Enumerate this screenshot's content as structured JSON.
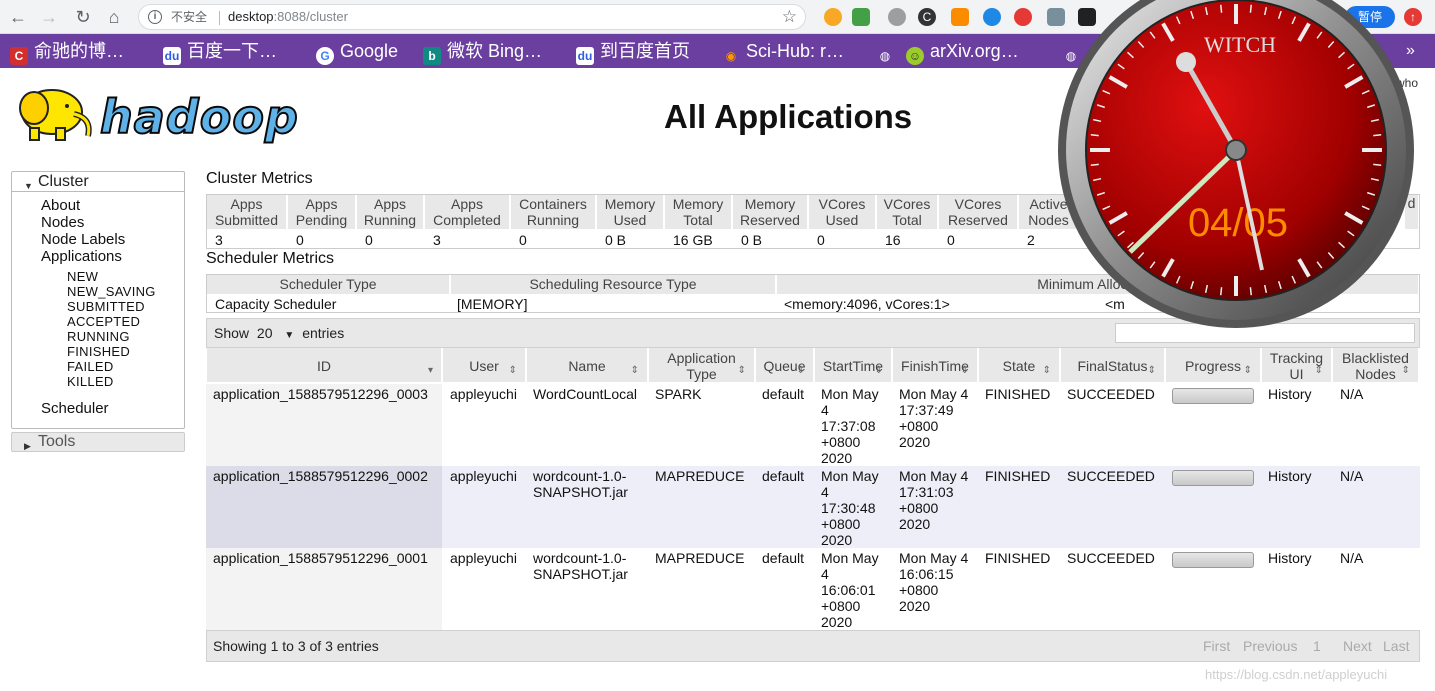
{
  "browser": {
    "insecure_label": "不安全",
    "url_host": "desktop",
    "url_rest": ":8088/cluster",
    "paused_label": "暂停"
  },
  "bookmarks": [
    {
      "label": "俞驰的博…",
      "icon_color": "#d32f2f",
      "icon_char": "C"
    },
    {
      "label": "百度一下…",
      "icon_color": "#2d5ee3",
      "icon_char": "du"
    },
    {
      "label": "Google",
      "icon_color": "#ffffff",
      "icon_char": "G"
    },
    {
      "label": "微软 Bing…",
      "icon_color": "#128a84",
      "icon_char": "b"
    },
    {
      "label": "到百度首页",
      "icon_color": "#2d5ee3",
      "icon_char": "du"
    },
    {
      "label": "Sci-Hub: r…",
      "icon_color": "#e65100",
      "icon_char": "◉"
    },
    {
      "label": "arXiv.org…",
      "icon_color": "#9ccc2a",
      "icon_char": "☺"
    }
  ],
  "header": {
    "logo_text": "hadoop",
    "title": "All Applications",
    "logged_in": "who"
  },
  "sidebar": {
    "cluster_label": "Cluster",
    "links": [
      "About",
      "Nodes",
      "Node Labels",
      "Applications"
    ],
    "states": [
      "NEW",
      "NEW_SAVING",
      "SUBMITTED",
      "ACCEPTED",
      "RUNNING",
      "FINISHED",
      "FAILED",
      "KILLED"
    ],
    "scheduler_label": "Scheduler",
    "tools_label": "Tools"
  },
  "cluster_metrics": {
    "title": "Cluster Metrics",
    "headers": [
      [
        "Apps",
        "Submitted"
      ],
      [
        "Apps",
        "Pending"
      ],
      [
        "Apps",
        "Running"
      ],
      [
        "Apps",
        "Completed"
      ],
      [
        "Containers",
        "Running"
      ],
      [
        "Memory",
        "Used"
      ],
      [
        "Memory",
        "Total"
      ],
      [
        "Memory",
        "Reserved"
      ],
      [
        "VCores",
        "Used"
      ],
      [
        "VCores",
        "Total"
      ],
      [
        "VCores",
        "Reserved"
      ],
      [
        "Active",
        "Nodes"
      ]
    ],
    "values": [
      "3",
      "0",
      "0",
      "3",
      "0",
      "0 B",
      "16 GB",
      "0 B",
      "0",
      "16",
      "0",
      "2"
    ],
    "last_header_fragment": "d"
  },
  "scheduler_metrics": {
    "title": "Scheduler Metrics",
    "headers": [
      "Scheduler Type",
      "Scheduling Resource Type",
      "Minimum Allocation"
    ],
    "values": [
      "Capacity Scheduler",
      "[MEMORY]",
      "<memory:4096, vCores:1>",
      "<m"
    ]
  },
  "table_controls": {
    "show_label": "Show",
    "page_size": "20",
    "entries_label": "entries"
  },
  "applications": {
    "columns": [
      [
        "ID"
      ],
      [
        "User"
      ],
      [
        "Name"
      ],
      [
        "Application",
        "Type"
      ],
      [
        "Queue"
      ],
      [
        "StartTime"
      ],
      [
        "FinishTime"
      ],
      [
        "State"
      ],
      [
        "FinalStatus"
      ],
      [
        "Progress"
      ],
      [
        "Tracking",
        "UI"
      ],
      [
        "Blacklisted",
        "Nodes"
      ]
    ],
    "rows": [
      {
        "id": "application_1588579512296_0003",
        "user": "appleyuchi",
        "name": [
          "WordCountLocal"
        ],
        "type": "SPARK",
        "queue": "default",
        "start": [
          "Mon May",
          "4",
          "17:37:08",
          "+0800",
          "2020"
        ],
        "finish": [
          "Mon May 4",
          "17:37:49",
          "+0800",
          "2020"
        ],
        "state": "FINISHED",
        "final_status": "SUCCEEDED",
        "progress": 1.0,
        "tracking": "History",
        "blacklisted": "N/A"
      },
      {
        "id": "application_1588579512296_0002",
        "user": "appleyuchi",
        "name": [
          "wordcount-1.0-",
          "SNAPSHOT.jar"
        ],
        "type": "MAPREDUCE",
        "queue": "default",
        "start": [
          "Mon May",
          "4",
          "17:30:48",
          "+0800",
          "2020"
        ],
        "finish": [
          "Mon May 4",
          "17:31:03",
          "+0800",
          "2020"
        ],
        "state": "FINISHED",
        "final_status": "SUCCEEDED",
        "progress": 1.0,
        "tracking": "History",
        "blacklisted": "N/A"
      },
      {
        "id": "application_1588579512296_0001",
        "user": "appleyuchi",
        "name": [
          "wordcount-1.0-",
          "SNAPSHOT.jar"
        ],
        "type": "MAPREDUCE",
        "queue": "default",
        "start": [
          "Mon May",
          "4",
          "16:06:01",
          "+0800",
          "2020"
        ],
        "finish": [
          "Mon May 4",
          "16:06:15",
          "+0800",
          "2020"
        ],
        "state": "FINISHED",
        "final_status": "SUCCEEDED",
        "progress": 1.0,
        "tracking": "History",
        "blacklisted": "N/A"
      }
    ],
    "showing": "Showing 1 to 3 of 3 entries",
    "pager": [
      "First",
      "Previous",
      "1",
      "Next",
      "Last"
    ]
  },
  "clock": {
    "brand": "WITCH",
    "date": "04/05"
  },
  "watermark": "https://blog.csdn.net/appleyuchi"
}
